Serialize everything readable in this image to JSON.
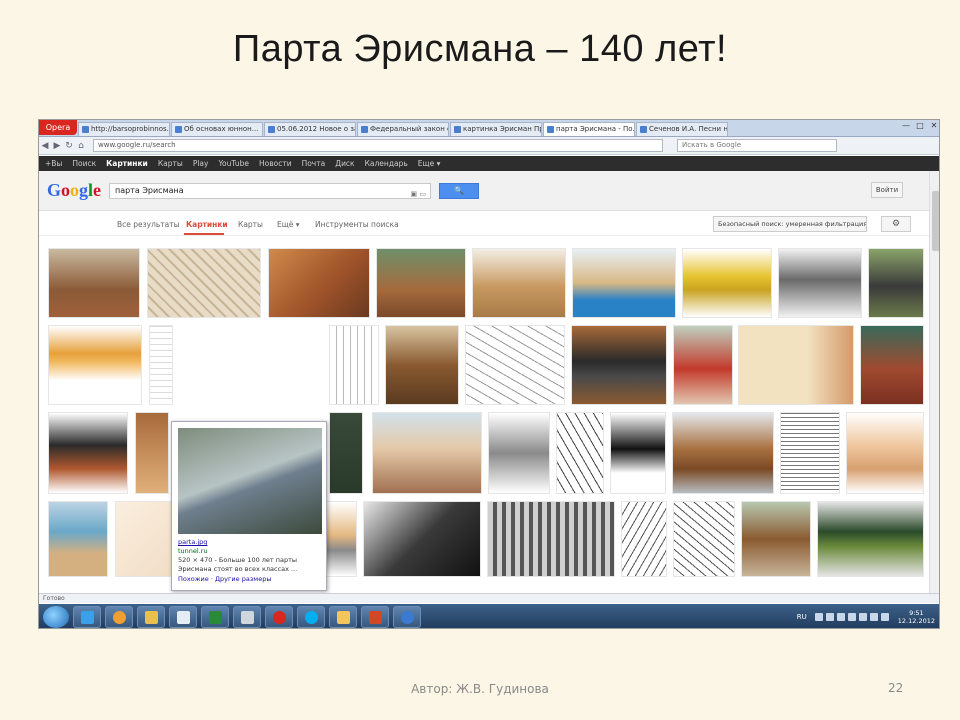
{
  "slide": {
    "title": "Парта Эрисмана – 140 лет!",
    "author": "Автор: Ж.В. Гудинова",
    "page_number": "22"
  },
  "browser": {
    "opera_label": "Opera",
    "tabs": [
      {
        "label": "http://barsoprobinnos..."
      },
      {
        "label": "Об основах юннон..."
      },
      {
        "label": "05.06.2012 Новое о зал..."
      },
      {
        "label": "Федеральный закон о..."
      },
      {
        "label": "картинка Эрисман Пр..."
      },
      {
        "label": "парта Эрисмана - По..."
      },
      {
        "label": "Сеченов И.А. Песни н..."
      }
    ],
    "window_controls": [
      "—",
      "□",
      "✕"
    ],
    "url": "www.google.ru/search",
    "search_placeholder": "Искать в Google"
  },
  "google_bar": {
    "items": [
      "+Вы",
      "Поиск",
      "Картинки",
      "Карты",
      "Play",
      "YouTube",
      "Новости",
      "Почта",
      "Диск",
      "Календарь",
      "Еще ▾"
    ],
    "selected": "Картинки"
  },
  "google": {
    "logo": "Google",
    "logo_colors": [
      "#3369e8",
      "#d50f25",
      "#eeb211",
      "#3369e8",
      "#009925",
      "#d50f25"
    ],
    "query": "парта Эрисмана",
    "search_button": "🔍",
    "signin": "Войти",
    "tools": {
      "all_results": "Все результаты",
      "images": "Картинки",
      "maps": "Карты",
      "more": "Ещё ▾",
      "search_tools": "Инструменты поиска"
    },
    "safesearch": "Безопасный поиск: умеренная фильтрация ▾",
    "settings_icon": "⚙"
  },
  "preview": {
    "filename": "parta.jpg",
    "domain": "tunnel.ru",
    "size": "520 × 470 - Больше 100 лет парты",
    "desc": "Эрисмана стоят во всех классах ...",
    "similar": "Похожие · Другие размеры"
  },
  "taskbar": {
    "lang": "RU",
    "time": "9:51",
    "date": "12.12.2012"
  },
  "statusbar": "Готово"
}
